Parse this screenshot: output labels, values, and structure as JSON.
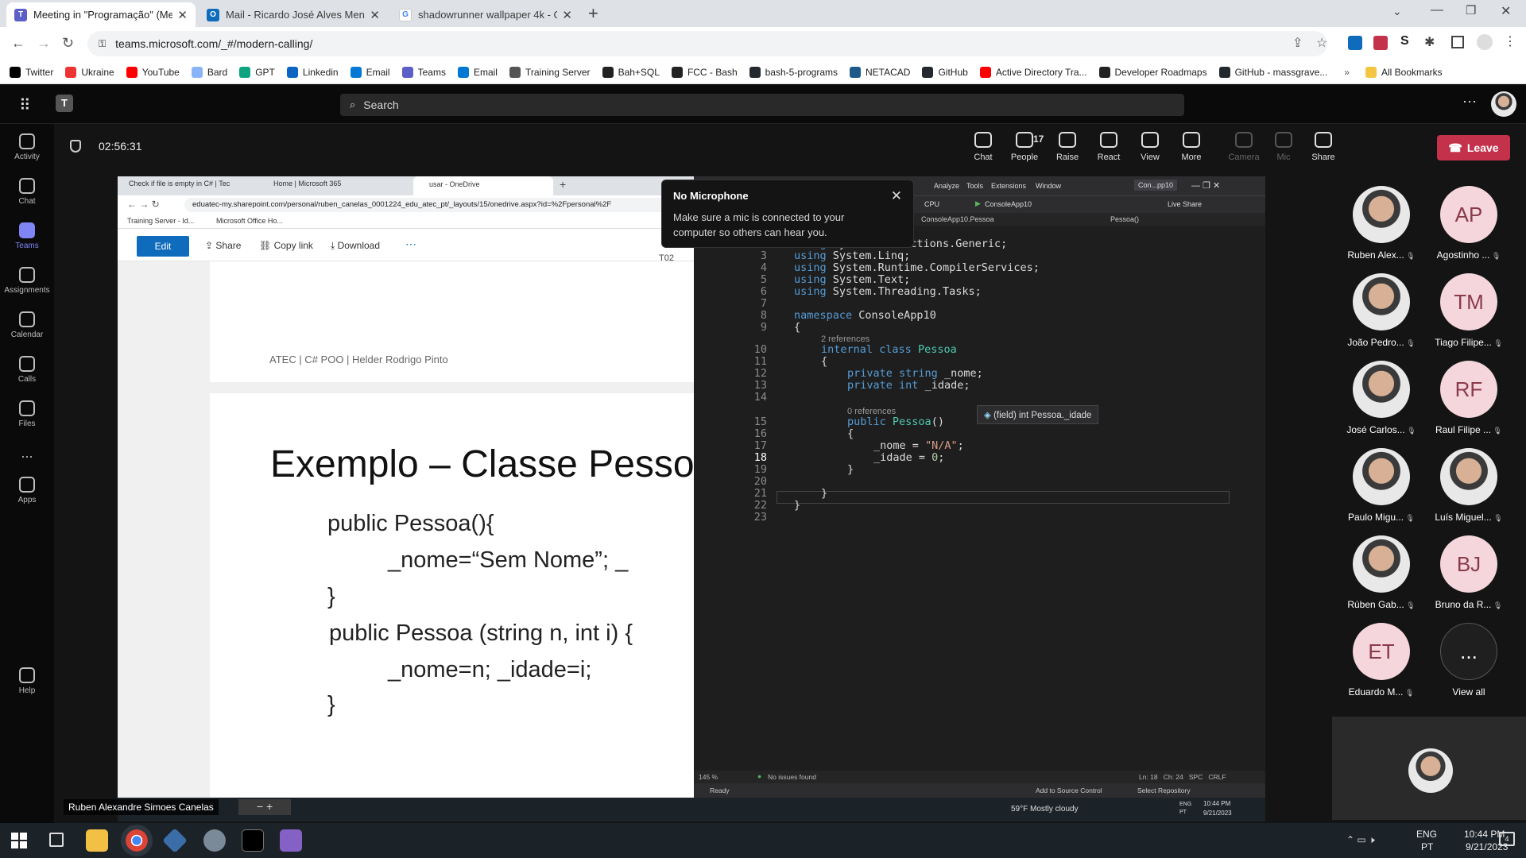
{
  "browser": {
    "tabs": [
      {
        "title": "Meeting in \"Programação\" (Meet",
        "color": "#5b5fc7",
        "active": true
      },
      {
        "title": "Mail - Ricardo José Alves Mende",
        "color": "#0f6cbd",
        "active": false
      },
      {
        "title": "shadowrunner wallpaper 4k - Go",
        "color": "#4285f4",
        "active": false
      }
    ],
    "url": "teams.microsoft.com/_#/modern-calling/",
    "bookmarks": [
      "Twitter",
      "Ukraine",
      "YouTube",
      "Bard",
      "GPT",
      "Linkedin",
      "Email",
      "Teams",
      "Email",
      "Training Server",
      "Bah+SQL",
      "FCC - Bash",
      "bash-5-programs",
      "NETACAD",
      "GitHub",
      "Active Directory Tra...",
      "Developer Roadmaps",
      "GitHub - massgrave..."
    ],
    "all_bookmarks": "All Bookmarks"
  },
  "teams": {
    "search_placeholder": "Search",
    "rail": [
      "Activity",
      "Chat",
      "Teams",
      "Assignments",
      "Calendar",
      "Calls",
      "Files",
      "...",
      "Apps",
      "Help"
    ],
    "timer": "02:56:31",
    "meeting_bar": [
      {
        "label": "Chat",
        "disabled": false
      },
      {
        "label": "People",
        "badge": "17",
        "disabled": false
      },
      {
        "label": "Raise",
        "disabled": false
      },
      {
        "label": "React",
        "disabled": false
      },
      {
        "label": "View",
        "disabled": false
      },
      {
        "label": "More",
        "disabled": false
      },
      {
        "label": "Camera",
        "disabled": true
      },
      {
        "label": "Mic",
        "disabled": true
      },
      {
        "label": "Share",
        "disabled": false
      }
    ],
    "leave": "Leave",
    "toast": {
      "title": "No Microphone",
      "body": "Make sure a mic is connected to your computer so others can hear you."
    },
    "presenter_name": "Ruben Alexandre Simoes Canelas",
    "participants": [
      {
        "name": "Ruben Alex...",
        "initials": "",
        "photo": true
      },
      {
        "name": "Agostinho ...",
        "initials": "AP",
        "photo": false
      },
      {
        "name": "João Pedro...",
        "initials": "",
        "photo": true
      },
      {
        "name": "Tiago Filipe...",
        "initials": "TM",
        "photo": false
      },
      {
        "name": "José Carlos...",
        "initials": "",
        "photo": true
      },
      {
        "name": "Raul Filipe ...",
        "initials": "RF",
        "photo": false
      },
      {
        "name": "Paulo Migu...",
        "initials": "",
        "photo": true
      },
      {
        "name": "Luís Miguel...",
        "initials": "",
        "photo": true
      },
      {
        "name": "Rúben Gab...",
        "initials": "",
        "photo": true
      },
      {
        "name": "Bruno da R...",
        "initials": "BJ",
        "photo": false
      },
      {
        "name": "Eduardo M...",
        "initials": "ET",
        "photo": false
      },
      {
        "name": "View all",
        "initials": "...",
        "photo": false
      }
    ]
  },
  "shared": {
    "tabs": [
      "Check if file is empty in C# | Tec",
      "Home | Microsoft 365",
      "usar - OneDrive"
    ],
    "url": "eduatec-my.sharepoint.com/personal/ruben_canelas_0001224_edu_atec_pt/_layouts/15/onedrive.aspx?id=%2Fpersonal%2F",
    "bookmarks": [
      "Training Server - Id...",
      "Microsoft Office Ho..."
    ],
    "toolbar": {
      "edit": "Edit",
      "share": "Share",
      "copy_link": "Copy link",
      "download": "Download"
    },
    "slide_footer": "ATEC | C# POO | Helder Rodrigo Pinto",
    "slide_title": "Exemplo – Classe Pesso",
    "slide_lines": [
      "public Pessoa(){",
      "_nome=“Sem Nome”; _",
      "}",
      "public Pessoa (string n, int i) {",
      "_nome=n; _idade=i;",
      "}"
    ],
    "vs": {
      "menu": [
        "Analyze",
        "Tools",
        "Extensions",
        "Window"
      ],
      "solution": "Con...pp10",
      "config": "CPU",
      "run": "ConsoleApp10",
      "live_share": "Live Share",
      "nav_left": "ConsoleApp10.Pessoa",
      "nav_right": "Pessoa()",
      "tooltip": "(field) int Pessoa._idade",
      "zoom": "145 %",
      "issues": "No issues found",
      "position": "Ln: 18   Ch: 24   SPC   CRLF",
      "status": "Ready",
      "source_control": "Add to Source Control",
      "repo": "Select Repository",
      "refs_class": "2 references",
      "refs_ctor": "0 references"
    },
    "inner_taskbar": {
      "weather": "59°F  Mostly cloudy",
      "lang": "ENG PT",
      "time": "10:44 PM",
      "date": "9/21/2023"
    }
  },
  "taskbar": {
    "lang1": "ENG",
    "lang2": "PT",
    "time": "10:44 PM",
    "date": "9/21/2023",
    "notif": "4"
  }
}
